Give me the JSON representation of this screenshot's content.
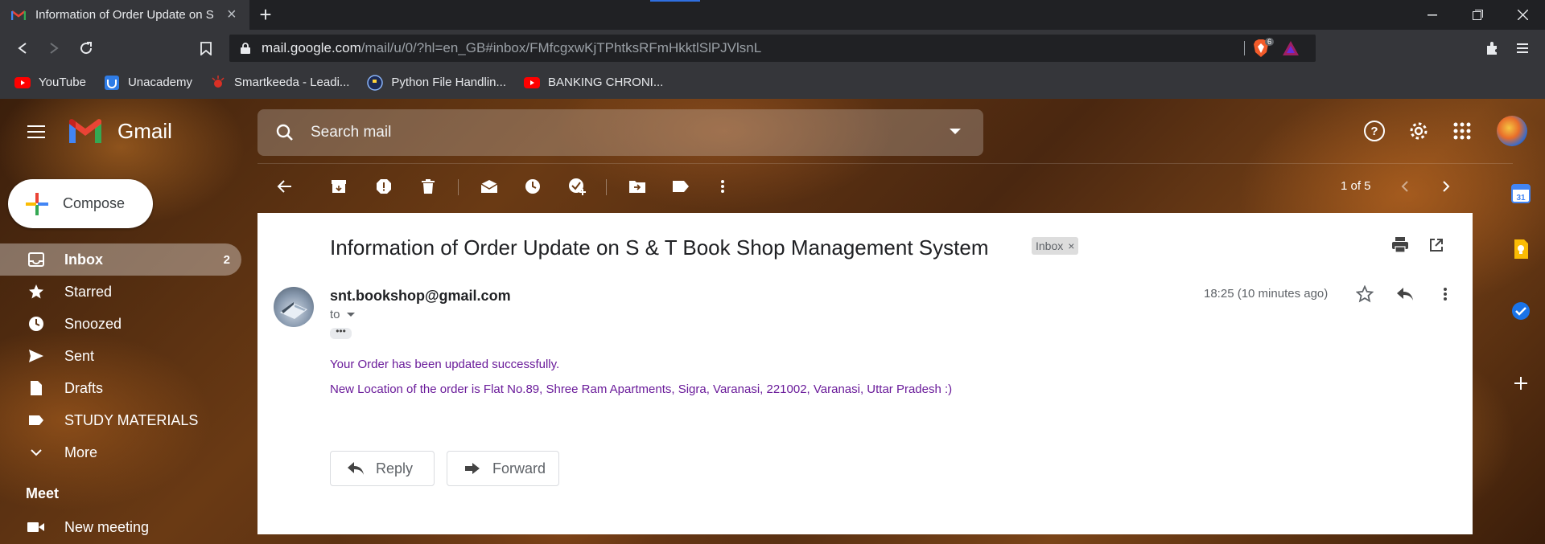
{
  "browser": {
    "tab_title": "Information of Order Update on S",
    "url_host": "mail.google.com",
    "url_path": "/mail/u/0/?hl=en_GB#inbox/FMfcgxwKjTPhtksRFmHkktlSlPJVlsnL",
    "brave_badge": "6",
    "bookmarks": [
      {
        "label": "YouTube",
        "icon": "youtube-icon"
      },
      {
        "label": "Unacademy",
        "icon": "unacademy-icon"
      },
      {
        "label": "Smartkeeda - Leadi...",
        "icon": "smartkeeda-icon"
      },
      {
        "label": "Python File Handlin...",
        "icon": "python-icon"
      },
      {
        "label": "BANKING CHRONI...",
        "icon": "youtube-icon"
      }
    ]
  },
  "gmail": {
    "logo_text": "Gmail",
    "search_placeholder": "Search mail",
    "compose_label": "Compose",
    "nav": [
      {
        "label": "Inbox",
        "count": "2",
        "icon": "inbox-icon"
      },
      {
        "label": "Starred",
        "count": "",
        "icon": "star-icon"
      },
      {
        "label": "Snoozed",
        "count": "",
        "icon": "clock-icon"
      },
      {
        "label": "Sent",
        "count": "",
        "icon": "send-icon"
      },
      {
        "label": "Drafts",
        "count": "",
        "icon": "draft-icon"
      },
      {
        "label": "STUDY MATERIALS",
        "count": "",
        "icon": "label-icon"
      },
      {
        "label": "More",
        "count": "",
        "icon": "chevron-down-icon"
      }
    ],
    "meet_title": "Meet",
    "meet_item": "New meeting",
    "pager": "1 of 5"
  },
  "message": {
    "subject": "Information of Order Update on S & T Book Shop Management System",
    "label": "Inbox",
    "sender": "snt.bookshop@gmail.com",
    "to": "to",
    "time": "18:25 (10 minutes ago)",
    "body": [
      "Your Order has been updated successfully.",
      "New Location of the order is Flat No.89, Shree Ram Apartments, Sigra, Varanasi, 221002, Varanasi, Uttar Pradesh :)"
    ],
    "reply_label": "Reply",
    "forward_label": "Forward"
  },
  "colors": {
    "chrome_dark": "#202124",
    "chrome_mid": "#35363a",
    "body_text": "#6a1b9a",
    "gmail_red": "#ea4335"
  }
}
